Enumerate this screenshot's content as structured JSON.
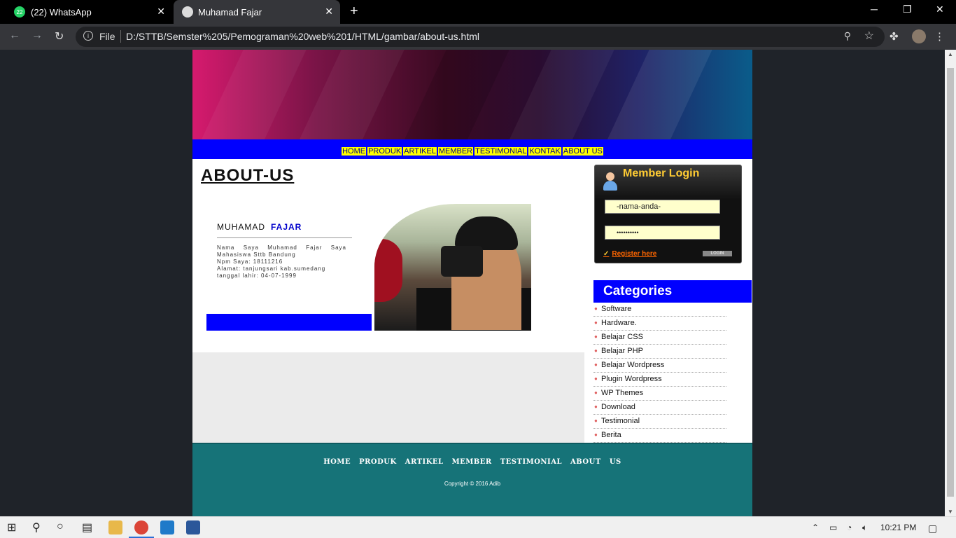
{
  "browser": {
    "tabs": [
      {
        "title": "(22) WhatsApp",
        "badge": "22",
        "icon": "whatsapp-icon"
      },
      {
        "title": "Muhamad Fajar",
        "icon": "globe-icon"
      }
    ],
    "url_scheme": "File",
    "url": "D:/STTB/Semster%205/Pemograman%20web%201/HTML/gambar/about-us.html"
  },
  "site": {
    "nav": [
      "HOME",
      "PRODUK",
      "ARTIKEL",
      "MEMBER",
      "TESTIMONIAL",
      "KONTAK",
      "ABOUT US"
    ],
    "page_title": "ABOUT-US",
    "profile": {
      "first_name": "MUHAMAD",
      "last_name": "FAJAR",
      "bio_line1": "Nama Saya Muhamad Fajar Saya Mahasiswa Sttb Bandung",
      "bio_line2": "Npm Saya: 18111216",
      "bio_line3": "Alamat: tanjungsari kab.sumedang",
      "bio_line4": "tanggal lahir: 04-07-1999"
    },
    "login": {
      "title": "Member Login",
      "username_value": "-nama-anda-",
      "password_value": "••••••••••",
      "register_label": "Register here",
      "button_label": "LOGIN"
    },
    "categories": {
      "title": "Categories",
      "items": [
        "Software",
        "Hardware.",
        "Belajar CSS",
        "Belajar PHP",
        "Belajar Wordpress",
        "Plugin Wordpress",
        "WP Themes",
        "Download",
        "Testimonial",
        "Berita"
      ]
    },
    "footer": {
      "nav": [
        "HOME",
        "PRODUK",
        "ARTIKEL",
        "MEMBER",
        "TESTIMONIAL",
        "ABOUT",
        "US"
      ],
      "copyright": "Copyright © 2016 Adib"
    }
  },
  "taskbar": {
    "clock": "10:21 PM"
  }
}
